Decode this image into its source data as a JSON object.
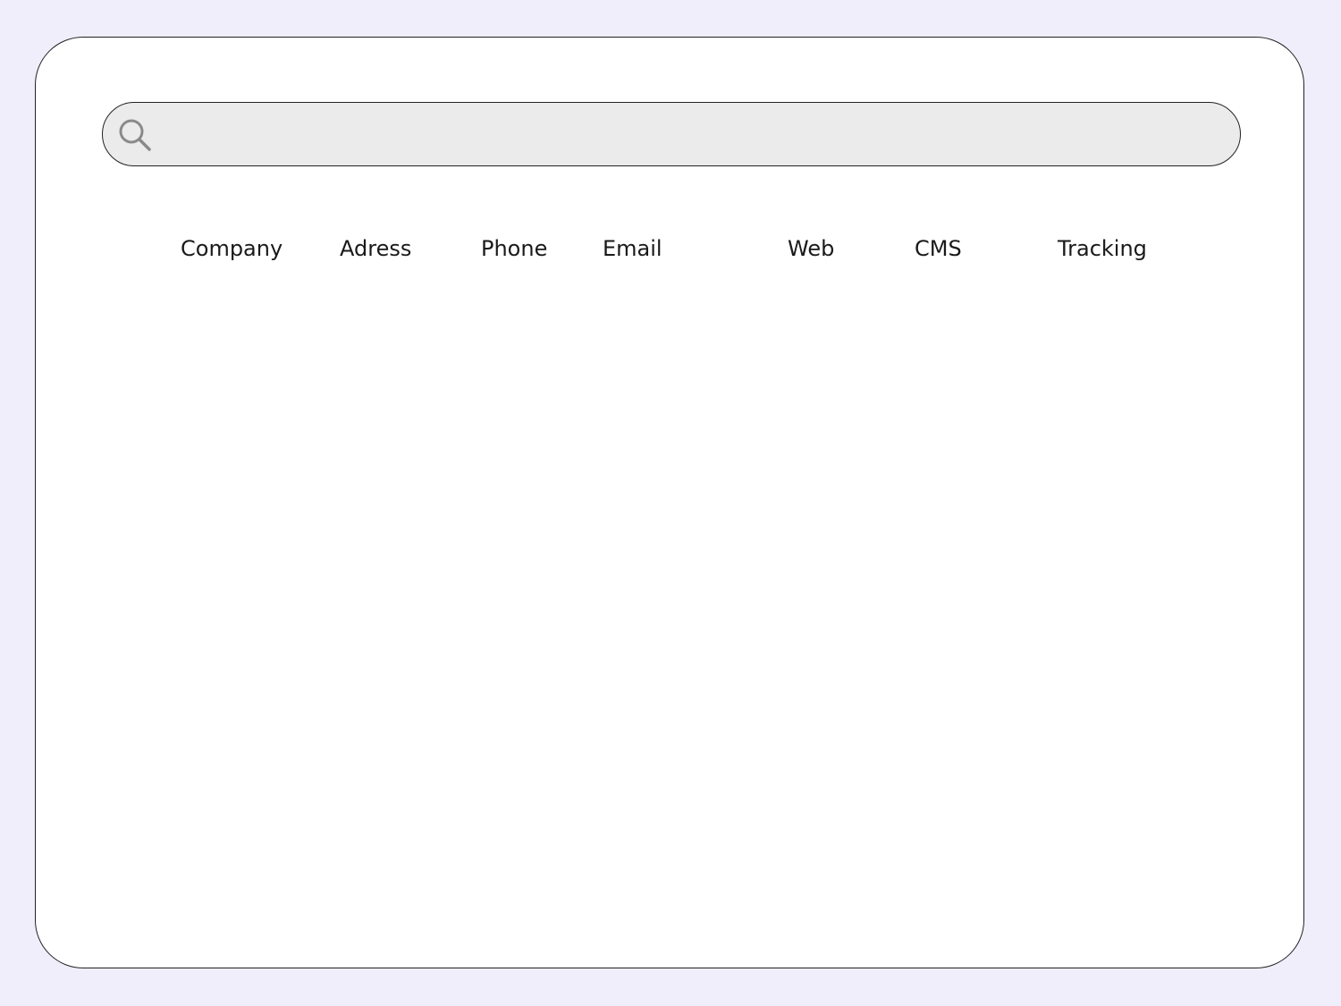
{
  "search": {
    "value": "",
    "placeholder": "",
    "icon": "search-icon"
  },
  "table": {
    "headers": [
      "Company",
      "Adress",
      "Phone",
      "Email",
      "Web",
      "CMS",
      "Tracking"
    ]
  },
  "colors": {
    "background": "#f0eefb",
    "window": "#ffffff",
    "search_fill": "#ebebeb",
    "border": "#222222",
    "icon": "#8a8a8a"
  }
}
